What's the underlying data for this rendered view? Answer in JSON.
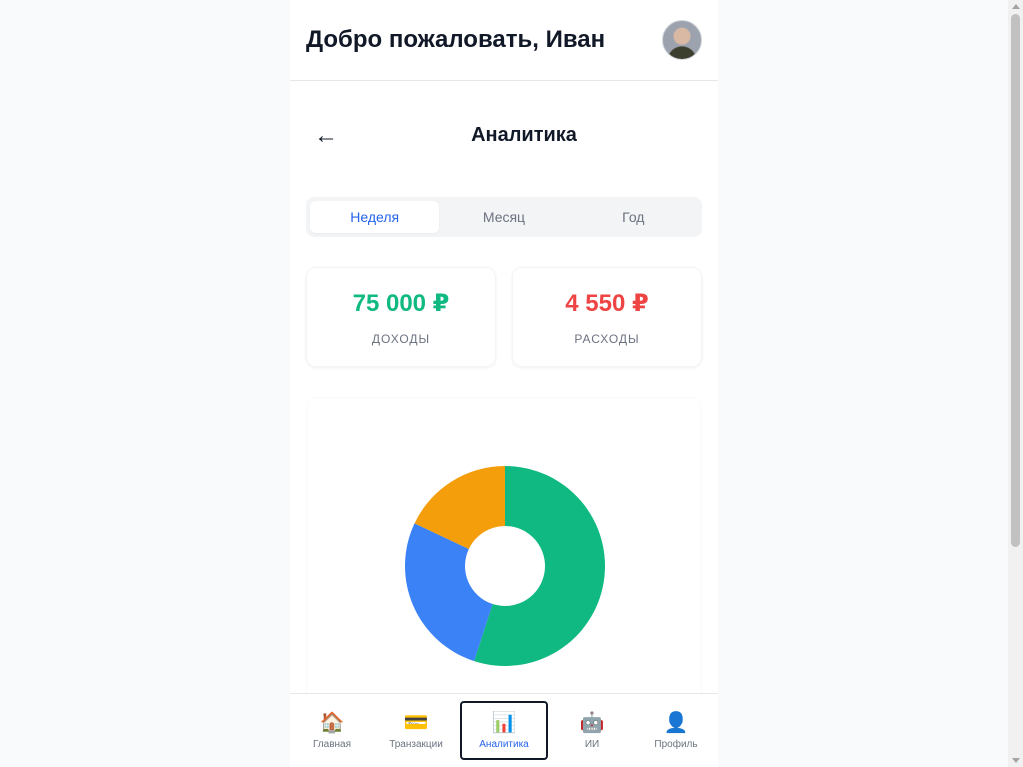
{
  "header": {
    "greeting": "Добро пожаловать, Иван",
    "avatar_icon": "user-photo"
  },
  "screen": {
    "back_icon": "←",
    "title": "Аналитика"
  },
  "tabs": [
    {
      "label": "Неделя",
      "active": true
    },
    {
      "label": "Месяц",
      "active": false
    },
    {
      "label": "Год",
      "active": false
    }
  ],
  "stats": {
    "income": {
      "value": "75 000 ₽",
      "label": "ДОХОДЫ",
      "color": "#10b981"
    },
    "expense": {
      "value": "4 550 ₽",
      "label": "РАСХОДЫ",
      "color": "#ef4444"
    }
  },
  "chart_data": {
    "type": "pie",
    "donut": true,
    "slices": [
      {
        "value": 55,
        "color": "#10b981"
      },
      {
        "value": 27,
        "color": "#3b82f6"
      },
      {
        "value": 18,
        "color": "#f59e0b"
      }
    ]
  },
  "nav": [
    {
      "label": "Главная",
      "icon": "🏠",
      "icon_name": "home-icon",
      "active": false
    },
    {
      "label": "Транзакции",
      "icon": "💳",
      "icon_name": "credit-card-icon",
      "active": false
    },
    {
      "label": "Аналитика",
      "icon": "📊",
      "icon_name": "bar-chart-icon",
      "active": true
    },
    {
      "label": "ИИ",
      "icon": "🤖",
      "icon_name": "robot-icon",
      "active": false
    },
    {
      "label": "Профиль",
      "icon": "👤",
      "icon_name": "profile-icon",
      "active": false
    }
  ]
}
